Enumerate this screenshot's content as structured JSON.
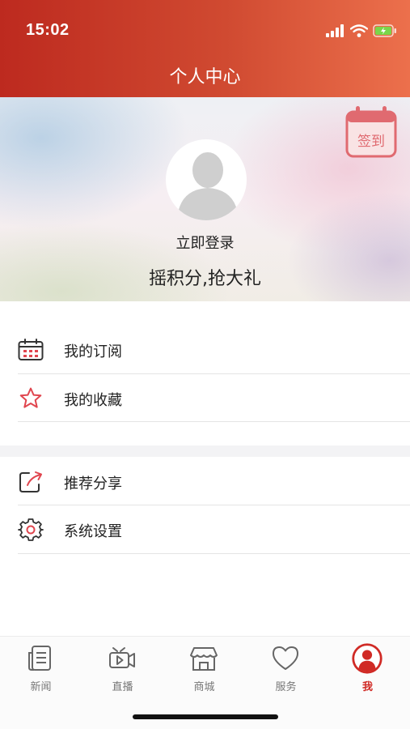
{
  "status_bar": {
    "time": "15:02"
  },
  "header": {
    "title": "个人中心"
  },
  "profile": {
    "signin_label": "签到",
    "login_label": "立即登录",
    "slogan": "摇积分,抢大礼"
  },
  "menu": {
    "group1": [
      {
        "label": "我的订阅",
        "icon": "calendar-icon"
      },
      {
        "label": "我的收藏",
        "icon": "star-icon"
      }
    ],
    "group2": [
      {
        "label": "推荐分享",
        "icon": "share-icon"
      },
      {
        "label": "系统设置",
        "icon": "gear-icon"
      }
    ]
  },
  "tabbar": {
    "items": [
      {
        "label": "新闻",
        "icon": "news-icon"
      },
      {
        "label": "直播",
        "icon": "video-icon"
      },
      {
        "label": "商城",
        "icon": "store-icon"
      },
      {
        "label": "服务",
        "icon": "heart-icon"
      },
      {
        "label": "我",
        "icon": "user-icon"
      }
    ],
    "active": "我"
  },
  "colors": {
    "header_start": "#bd2a1f",
    "header_end": "#ec704c",
    "accent": "#d02a25",
    "signin_accent": "#e06a70"
  }
}
